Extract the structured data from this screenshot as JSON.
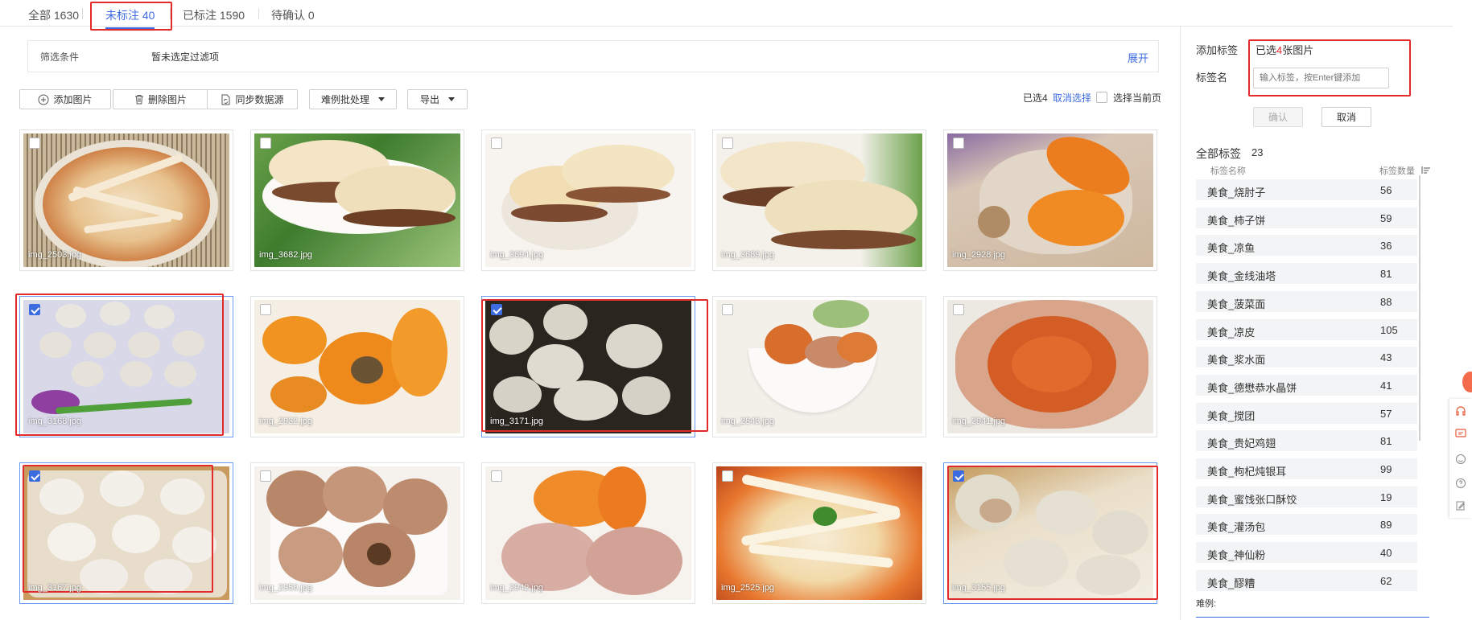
{
  "tabs": [
    {
      "label": "全部 1630"
    },
    {
      "label": "未标注 40"
    },
    {
      "label": "已标注 1590"
    },
    {
      "label": "待确认 0"
    }
  ],
  "filter": {
    "label": "筛选条件",
    "value": "暂未选定过滤项",
    "expand": "展开"
  },
  "toolbar": {
    "add": "添加图片",
    "delete": "删除图片",
    "sync": "同步数据源",
    "batch": "难例批处理",
    "export": "导出",
    "selected": "已选4",
    "cancel_select": "取消选择",
    "select_page": "选择当前页"
  },
  "images": [
    {
      "name": "img_2503.jpg",
      "checked": false
    },
    {
      "name": "img_3682.jpg",
      "checked": false
    },
    {
      "name": "img_3694.jpg",
      "checked": false
    },
    {
      "name": "img_3689.jpg",
      "checked": false
    },
    {
      "name": "img_2928.jpg",
      "checked": false
    },
    {
      "name": "img_3168.jpg",
      "checked": true
    },
    {
      "name": "img_2932.jpg",
      "checked": false
    },
    {
      "name": "img_3171.jpg",
      "checked": true
    },
    {
      "name": "img_2843.jpg",
      "checked": false
    },
    {
      "name": "img_2941.jpg",
      "checked": false
    },
    {
      "name": "img_3167.jpg",
      "checked": true
    },
    {
      "name": "img_2950.jpg",
      "checked": false
    },
    {
      "name": "img_2942.jpg",
      "checked": false
    },
    {
      "name": "img_2525.jpg",
      "checked": false
    },
    {
      "name": "img_3155.jpg",
      "checked": true
    }
  ],
  "panel": {
    "add_label": "添加标签",
    "selected_prefix": "已选",
    "selected_count": "4",
    "selected_suffix": "张图片",
    "name_label": "标签名",
    "input_placeholder": "输入标签，按Enter键添加",
    "confirm": "确认",
    "cancel": "取消",
    "all_tags": "全部标签",
    "all_tags_count": "23",
    "col_name": "标签名称",
    "col_count": "标签数量",
    "tags": [
      {
        "name": "美食_烧肘子",
        "count": "56"
      },
      {
        "name": "美食_柿子饼",
        "count": "59"
      },
      {
        "name": "美食_凉鱼",
        "count": "36"
      },
      {
        "name": "美食_金线油塔",
        "count": "81"
      },
      {
        "name": "美食_菠菜面",
        "count": "88"
      },
      {
        "name": "美食_凉皮",
        "count": "105"
      },
      {
        "name": "美食_浆水面",
        "count": "43"
      },
      {
        "name": "美食_德懋恭水晶饼",
        "count": "41"
      },
      {
        "name": "美食_搅团",
        "count": "57"
      },
      {
        "name": "美食_贵妃鸡翅",
        "count": "81"
      },
      {
        "name": "美食_枸杞炖银耳",
        "count": "99"
      },
      {
        "name": "美食_蜜饯张口酥饺",
        "count": "19"
      },
      {
        "name": "美食_灌汤包",
        "count": "89"
      },
      {
        "name": "美食_神仙粉",
        "count": "40"
      },
      {
        "name": "美食_醪糟",
        "count": "62"
      }
    ],
    "hard_label": "难例:"
  },
  "colors": {
    "accent": "#3d6be0",
    "highlight": "#e22a2a"
  }
}
